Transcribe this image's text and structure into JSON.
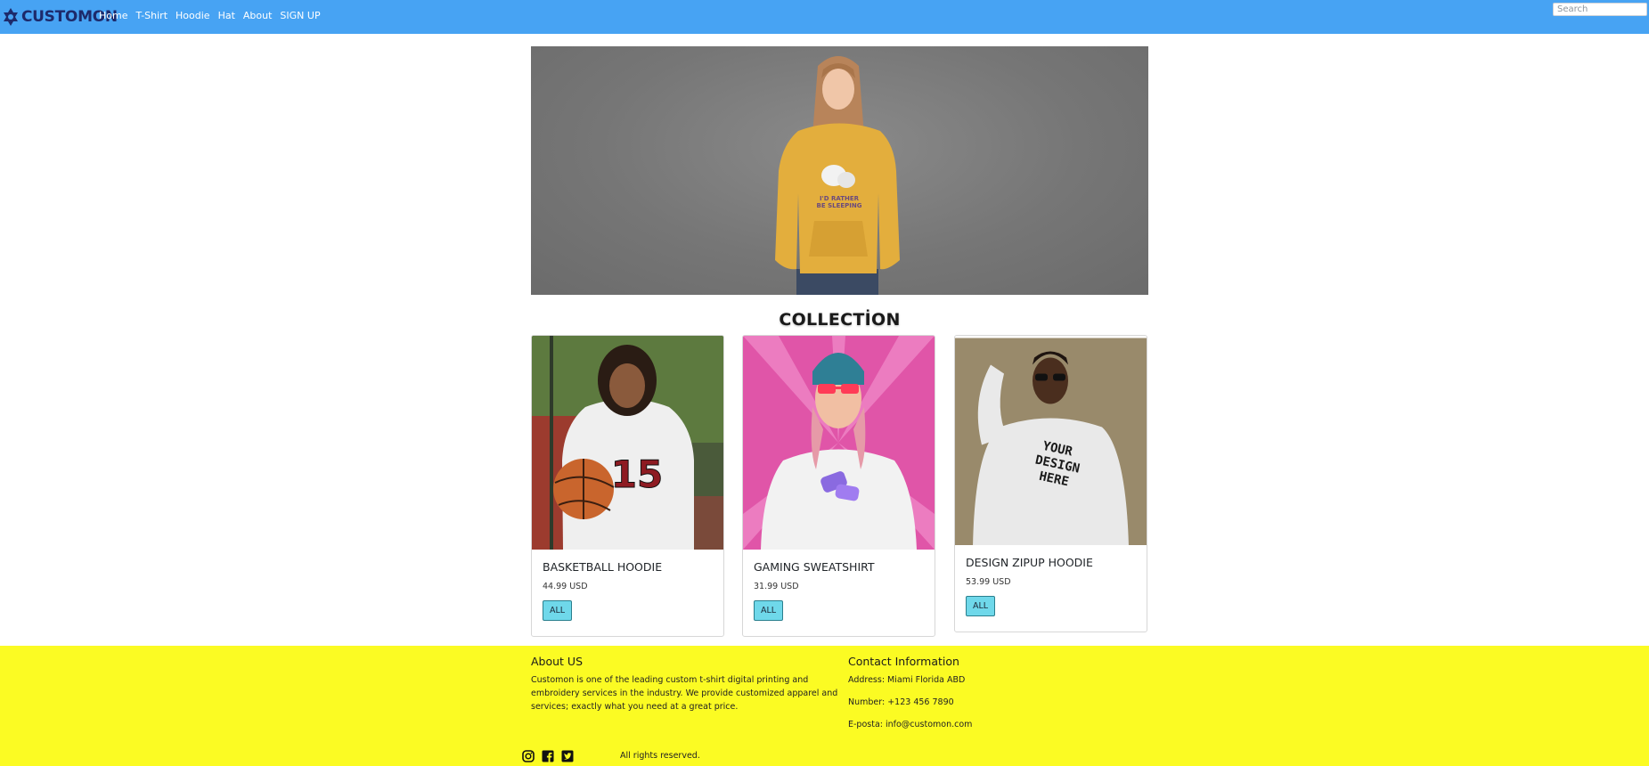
{
  "navbar": {
    "brand": "CUSTOMON",
    "links": [
      "Home",
      "T-Shirt",
      "Hoodie",
      "Hat",
      "About",
      "SIGN UP"
    ],
    "search_placeholder": "Search",
    "color": "#47a3f3"
  },
  "hero": {
    "print_line1": "I'D RATHER",
    "print_line2": "BE SLEEPING"
  },
  "collection": {
    "title": "COLLECTİON",
    "cards": [
      {
        "title": "BASKETBALL HOODIE",
        "price": "44.99 USD",
        "button": "ALL",
        "print": "15"
      },
      {
        "title": "GAMING SWEATSHIRT",
        "price": "31.99 USD",
        "button": "ALL"
      },
      {
        "title": "DESIGN ZIPUP HOODIE",
        "price": "53.99 USD",
        "button": "ALL",
        "print": "YOUR DESIGN HERE"
      }
    ]
  },
  "footer": {
    "color": "#fbfb23",
    "about_title": "About US",
    "about_text_1": "Customon is one of the leading custom t-shirt digital printing and",
    "about_text_2": "embroidery services in the industry. We provide customized apparel and",
    "about_text_3": "services; exactly what you need at a great price.",
    "contact_title": "Contact Information",
    "address": "Address: Miami Florida ABD",
    "number": "Number: +123 456 7890",
    "email": "E-posta: info@customon.com",
    "rights": "All rights reserved.",
    "social_icons": [
      "instagram-icon",
      "facebook-icon",
      "twitter-icon"
    ]
  }
}
